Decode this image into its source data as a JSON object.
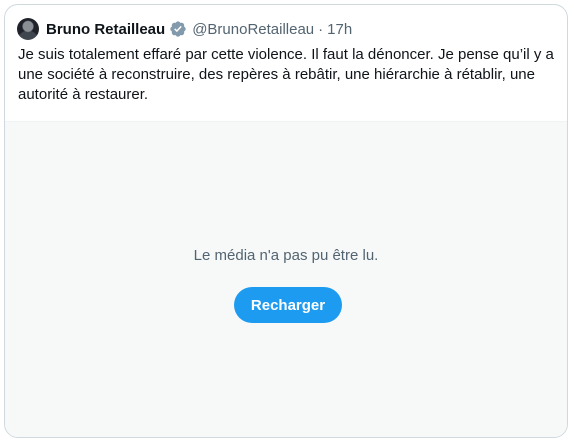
{
  "tweet": {
    "author_name": "Bruno Retailleau",
    "author_handle": "@BrunoRetailleau",
    "separator": "·",
    "timestamp": "17h",
    "text": "Je suis totalement effaré par cette violence. Il faut la dénoncer. Je pense qu’il y a une société à reconstruire, des repères à rebâtir, une hiérarchie à rétablir, une autorité à restaurer.",
    "verified": true
  },
  "media": {
    "error_message": "Le média n'a pas pu être lu.",
    "reload_label": "Recharger"
  },
  "colors": {
    "accent": "#1d9bf0",
    "verified_badge": "#829aab",
    "secondary_text": "#536471",
    "media_background": "#f7f9f9"
  },
  "icons": {
    "verified": "verified-badge-icon",
    "avatar": "profile-avatar"
  }
}
